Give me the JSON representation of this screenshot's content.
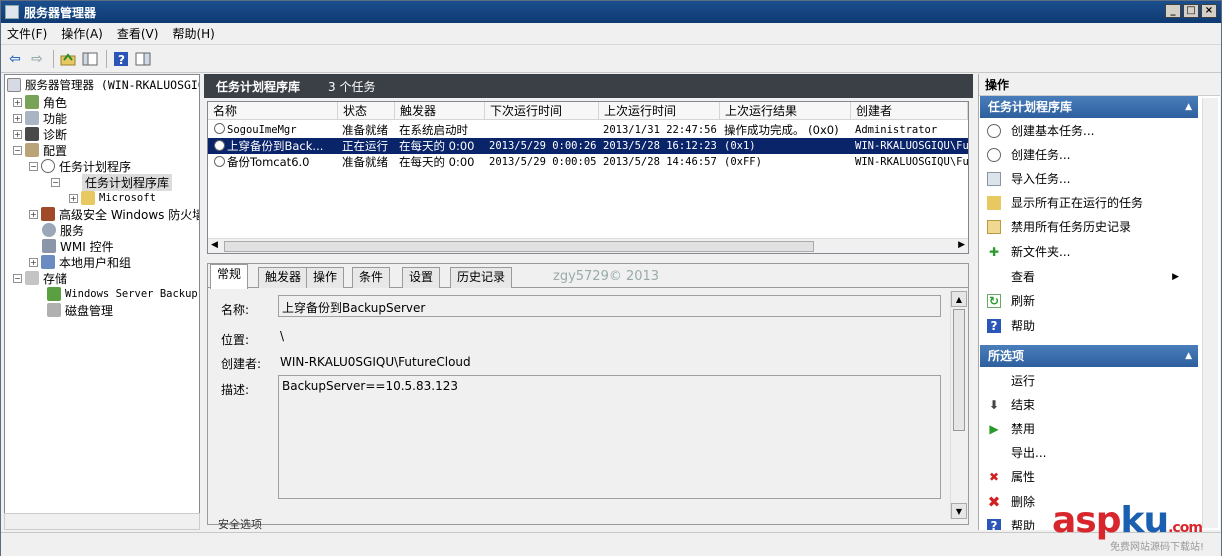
{
  "window": {
    "title": "服务器管理器",
    "buttons": [
      "_",
      "□",
      "×"
    ]
  },
  "menu": [
    "文件(F)",
    "操作(A)",
    "查看(V)",
    "帮助(H)"
  ],
  "tree": {
    "root": "服务器管理器 (WIN-RKALUOSGIQU)",
    "items": [
      {
        "label": "角色",
        "expander": "+"
      },
      {
        "label": "功能",
        "expander": "+"
      },
      {
        "label": "诊断",
        "expander": "+"
      },
      {
        "label": "配置",
        "expander": "−"
      },
      {
        "label": "任务计划程序",
        "expander": "−"
      },
      {
        "label": "任务计划程序库",
        "expander": "−"
      },
      {
        "label": "Microsoft",
        "expander": "+"
      },
      {
        "label": "高级安全 Windows 防火墙",
        "expander": "+"
      },
      {
        "label": "服务",
        "expander": ""
      },
      {
        "label": "WMI 控件",
        "expander": ""
      },
      {
        "label": "本地用户和组",
        "expander": "+"
      },
      {
        "label": "存储",
        "expander": "−"
      },
      {
        "label": "Windows Server Backup",
        "expander": ""
      },
      {
        "label": "磁盘管理",
        "expander": ""
      }
    ]
  },
  "center": {
    "title": "任务计划程序库",
    "count": "3 个任务",
    "columns": [
      "名称",
      "状态",
      "触发器",
      "下次运行时间",
      "上次运行时间",
      "上次运行结果",
      "创建者"
    ],
    "rows": [
      [
        "SogouImeMgr",
        "准备就绪",
        "在系统启动时",
        "",
        "2013/1/31 22:47:56",
        "操作成功完成。 (0x0)",
        "Administrator"
      ],
      [
        "上穿备份到Back...",
        "正在运行",
        "在每天的 0:00",
        "2013/5/29 0:00:26",
        "2013/5/28 16:12:23",
        "(0x1)",
        "WIN-RKALUOSGIQU\\Fu"
      ],
      [
        "备份Tomcat6.0",
        "准备就绪",
        "在每天的 0:00",
        "2013/5/29 0:00:05",
        "2013/5/28 14:46:57",
        "(0xFF)",
        "WIN-RKALUOSGIQU\\Fu"
      ]
    ]
  },
  "detail": {
    "tabs": [
      "常规",
      "触发器",
      "操作",
      "条件",
      "设置",
      "历史记录"
    ],
    "watermark": "zgy5729© 2013",
    "name_label": "名称:",
    "name_value": "上穿备份到BackupServer",
    "location_label": "位置:",
    "location_value": "\\",
    "author_label": "创建者:",
    "author_value": "WIN-RKALU0SGIQU\\FutureCloud",
    "desc_label": "描述:",
    "desc_value": "BackupServer==10.5.83.123",
    "security_label": "安全选项"
  },
  "actions": {
    "header": "操作",
    "section1": "任务计划程序库",
    "items1": [
      "创建基本任务...",
      "创建任务...",
      "导入任务...",
      "显示所有正在运行的任务",
      "禁用所有任务历史记录",
      "新文件夹...",
      "查看",
      "刷新",
      "帮助"
    ],
    "section2": "所选项",
    "items2": [
      "运行",
      "结束",
      "禁用",
      "导出...",
      "属性",
      "删除",
      "帮助"
    ]
  },
  "logo": {
    "text_a": "asp",
    "text_b": "ku",
    "suffix": ".com",
    "sub": "免费网站源码下载站!"
  },
  "colors": {
    "titlebar": "#1b4e8e",
    "selection": "#0a246a",
    "section_header": "#4a7ebb",
    "dark_header": "#3b3f46"
  }
}
